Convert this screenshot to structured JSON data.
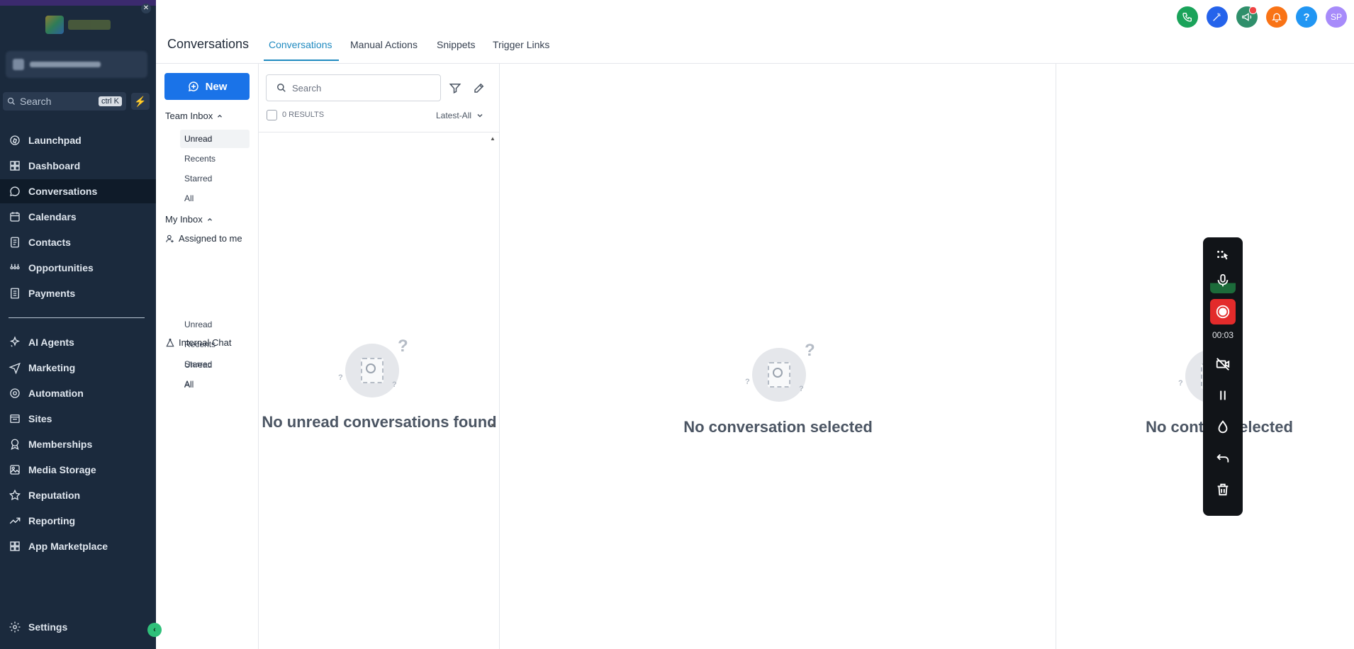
{
  "sidebar": {
    "search_placeholder": "Search",
    "search_shortcut": "ctrl K",
    "nav": [
      {
        "label": "Launchpad",
        "icon": "launchpad-icon"
      },
      {
        "label": "Dashboard",
        "icon": "dashboard-icon"
      },
      {
        "label": "Conversations",
        "icon": "chat-bubble-icon",
        "active": true
      },
      {
        "label": "Calendars",
        "icon": "calendar-icon"
      },
      {
        "label": "Contacts",
        "icon": "contacts-icon"
      },
      {
        "label": "Opportunities",
        "icon": "opportunities-icon"
      },
      {
        "label": "Payments",
        "icon": "payments-icon"
      },
      {
        "label": "AI Agents",
        "icon": "ai-sparkle-icon"
      },
      {
        "label": "Marketing",
        "icon": "send-icon"
      },
      {
        "label": "Automation",
        "icon": "automation-icon"
      },
      {
        "label": "Sites",
        "icon": "sites-icon"
      },
      {
        "label": "Memberships",
        "icon": "membership-badge-icon"
      },
      {
        "label": "Media Storage",
        "icon": "image-icon"
      },
      {
        "label": "Reputation",
        "icon": "star-icon"
      },
      {
        "label": "Reporting",
        "icon": "trend-icon"
      },
      {
        "label": "App Marketplace",
        "icon": "grid-icon"
      }
    ],
    "settings_label": "Settings"
  },
  "header": {
    "page_title": "Conversations",
    "tabs": [
      "Conversations",
      "Manual Actions",
      "Snippets",
      "Trigger Links"
    ],
    "active_tab": "Conversations",
    "avatar_initials": "SP",
    "icons": [
      {
        "name": "phone-icon",
        "color": "#1aa35a"
      },
      {
        "name": "magic-wand-icon",
        "color": "#2563eb"
      },
      {
        "name": "megaphone-icon",
        "color": "#2f8f6b"
      },
      {
        "name": "bell-icon",
        "color": "#f97316"
      },
      {
        "name": "help-icon",
        "color": "#2196f3"
      },
      {
        "name": "avatar",
        "color": "#a78bfa"
      }
    ]
  },
  "filters": {
    "new_label": "New",
    "team_inbox": {
      "label": "Team Inbox",
      "items": [
        "Unread",
        "Recents",
        "Starred",
        "All"
      ],
      "active": "Unread"
    },
    "my_inbox": {
      "label": "My Inbox"
    },
    "assigned_to_me": {
      "label": "Assigned to me",
      "items": [
        "Unread",
        "Recents",
        "Starred",
        "All"
      ]
    },
    "internal_chat": {
      "label": "Internal Chat",
      "items": [
        "Unread",
        "All"
      ]
    }
  },
  "list": {
    "search_placeholder": "Search",
    "results_label": "0 RESULTS",
    "sort_label": "Latest-All",
    "empty_message": "No unread conversations found"
  },
  "center": {
    "empty_message": "No conversation selected"
  },
  "right": {
    "empty_message": "No contact selected"
  },
  "recorder": {
    "timer": "00:03"
  }
}
